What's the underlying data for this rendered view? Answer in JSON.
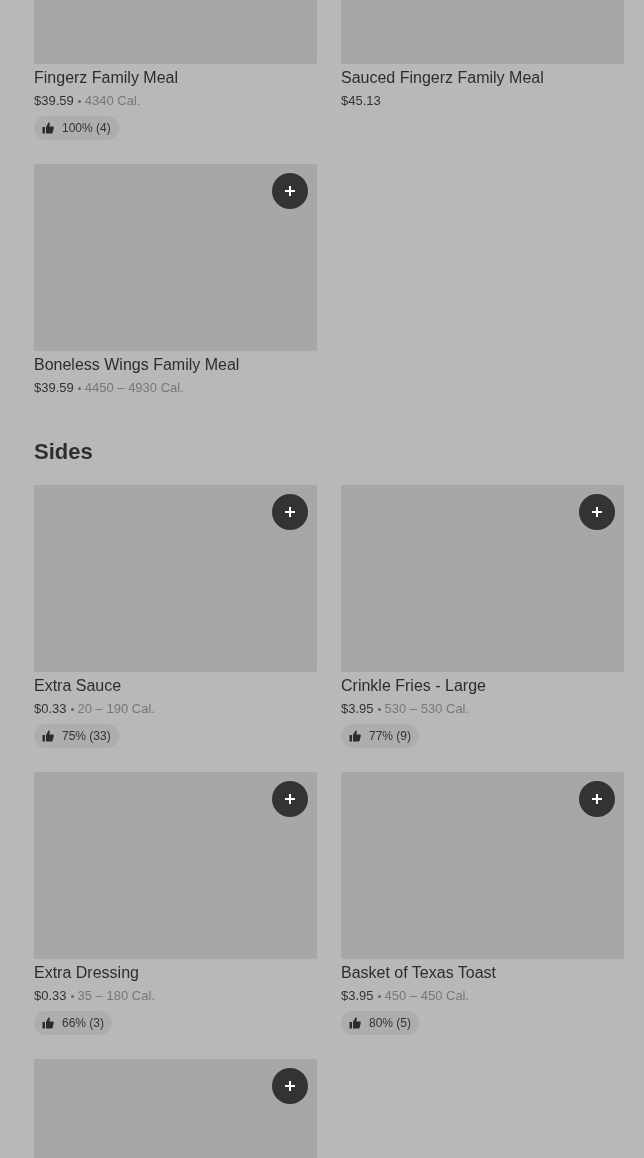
{
  "sections": [
    {
      "items": [
        {
          "name": "Fingerz Family Meal",
          "price": "$39.59",
          "calories": "4340 Cal.",
          "rating": "100% (4)",
          "add_button": false
        },
        {
          "name": "Sauced Fingerz Family Meal",
          "price": "$45.13",
          "add_button": false
        },
        {
          "name": "Boneless Wings Family Meal",
          "price": "$39.59",
          "calories": "4450 – 4930 Cal.",
          "add_button": true
        }
      ]
    },
    {
      "title": "Sides",
      "items": [
        {
          "name": "Extra Sauce",
          "price": "$0.33",
          "calories": "20 – 190 Cal.",
          "rating": "75% (33)",
          "add_button": true
        },
        {
          "name": "Crinkle Fries - Large",
          "price": "$3.95",
          "calories": "530 – 530 Cal.",
          "rating": "77% (9)",
          "add_button": true
        },
        {
          "name": "Extra Dressing",
          "price": "$0.33",
          "calories": "35 – 180 Cal.",
          "rating": "66% (3)",
          "add_button": true
        },
        {
          "name": "Basket of Texas Toast",
          "price": "$3.95",
          "calories": "450 – 450 Cal.",
          "rating": "80% (5)",
          "add_button": true
        },
        {
          "add_button": true
        }
      ]
    }
  ]
}
